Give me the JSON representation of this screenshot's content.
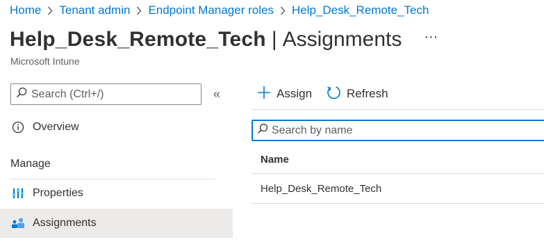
{
  "breadcrumb": [
    {
      "label": "Home"
    },
    {
      "label": "Tenant admin"
    },
    {
      "label": "Endpoint Manager roles"
    },
    {
      "label": "Help_Desk_Remote_Tech"
    }
  ],
  "header": {
    "title": "Help_Desk_Remote_Tech",
    "separator": "|",
    "section": "Assignments",
    "more_label": "···",
    "subtitle": "Microsoft Intune"
  },
  "sidebar": {
    "search_placeholder": "Search (Ctrl+/)",
    "collapse_label": "«",
    "overview_label": "Overview",
    "section_title": "Manage",
    "items": [
      {
        "label": "Properties",
        "icon": "properties-icon"
      },
      {
        "label": "Assignments",
        "icon": "assignments-icon",
        "selected": true
      }
    ]
  },
  "toolbar": {
    "assign_label": "Assign",
    "refresh_label": "Refresh"
  },
  "main": {
    "search_placeholder": "Search by name",
    "table": {
      "columns": [
        "Name"
      ],
      "rows": [
        [
          "Help_Desk_Remote_Tech"
        ]
      ]
    }
  },
  "colors": {
    "accent": "#0078d4",
    "selected_bg": "#edebe9",
    "divider": "#e1dfdd"
  }
}
